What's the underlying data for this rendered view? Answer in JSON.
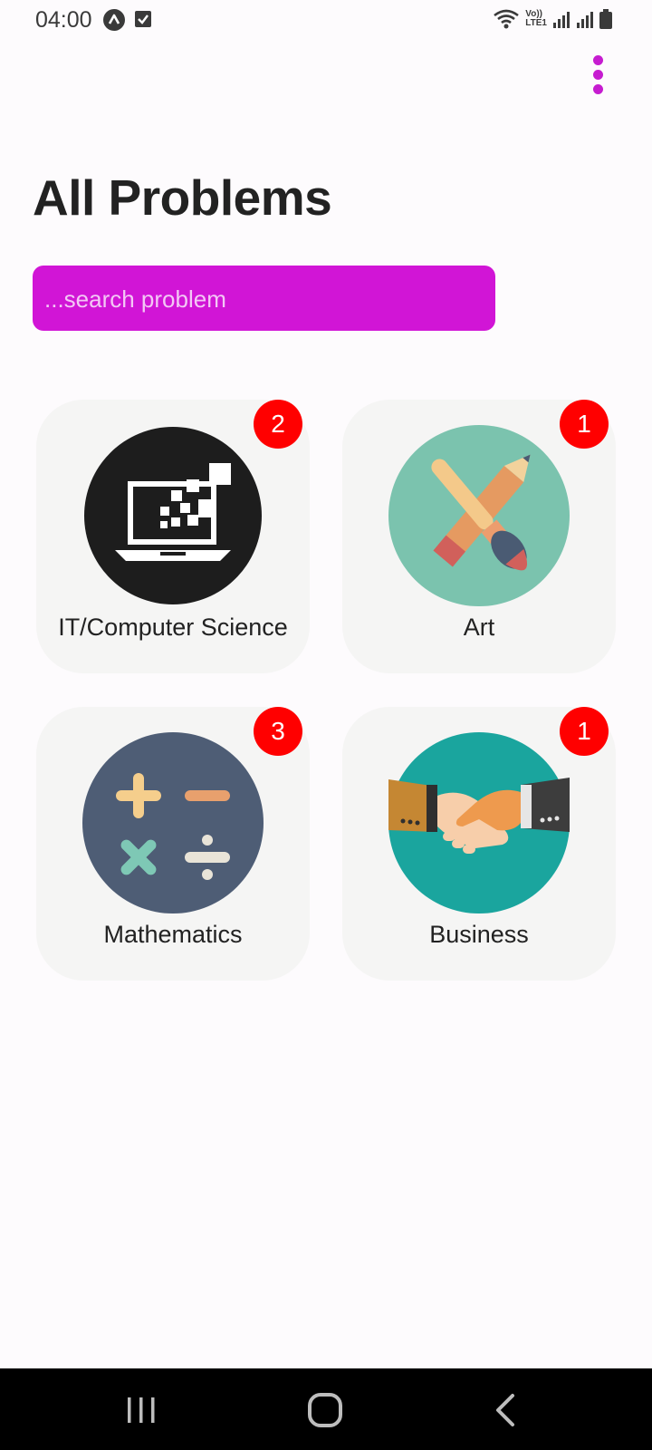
{
  "status_bar": {
    "time": "04:00",
    "network_label_top": "Vo))",
    "network_label_bottom": "LTE1",
    "icons": [
      "a-circle-icon",
      "check-square-icon",
      "wifi-icon",
      "signal-icon",
      "signal-icon",
      "battery-icon"
    ]
  },
  "header": {
    "menu_icon": "more-vert-icon",
    "accent": "#c61cd0"
  },
  "page": {
    "title": "All Problems"
  },
  "search": {
    "placeholder": "...search problem",
    "value": "",
    "background": "#d115d6"
  },
  "categories": [
    {
      "label": "IT/Computer Science",
      "count": "2",
      "icon": "laptop-icon"
    },
    {
      "label": "Art",
      "count": "1",
      "icon": "pencil-brush-icon"
    },
    {
      "label": "Mathematics",
      "count": "3",
      "icon": "math-operators-icon"
    },
    {
      "label": "Business",
      "count": "1",
      "icon": "handshake-icon"
    }
  ],
  "badge_color": "#ff0000",
  "nav_bar": {
    "buttons": [
      "recents-icon",
      "home-icon",
      "back-icon"
    ]
  }
}
